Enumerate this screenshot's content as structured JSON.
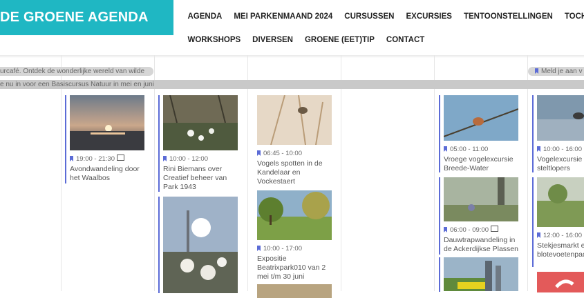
{
  "header": {
    "logo": "DE GROENE AGENDA"
  },
  "nav": {
    "row1": [
      "AGENDA",
      "MEI PARKENMAAND 2024",
      "CURSUSSEN",
      "EXCURSIES",
      "TENTOONSTELLINGEN",
      "TOCHTEN"
    ],
    "row2": [
      "WORKSHOPS",
      "DIVERSEN",
      "GROENE (EET)TIP",
      "CONTACT"
    ]
  },
  "banners": {
    "b1": "urcafé. Ontdek de wonderlijke wereld van wilde",
    "b2": "e nu in voor een Basiscursus Natuur in mei en juni",
    "b3": "Meld je aan v"
  },
  "events": [
    {
      "time": "19:00 - 21:30",
      "title": "Avondwandeling door het Waalbos",
      "recurring": true
    },
    {
      "time": "10:00 - 12:00",
      "title": "Rini Biemans over Creatief beheer van Park 1943",
      "recurring": false
    },
    {
      "time": "06:45 - 10:00",
      "title": "Vogels spotten in de Kandelaar en Vockestaert",
      "recurring": false
    },
    {
      "time": "10:00 - 17:00",
      "title": "Expositie Beatrixpark010 van 2 mei t/m 30 juni",
      "recurring": false
    },
    {
      "time": "05:00 - 11:00",
      "title": "Vroege vogelexcursie Breede-Water",
      "recurring": false
    },
    {
      "time": "06:00 - 09:00",
      "title": "Dauwtrapwandeling in de Ackerdijkse Plassen",
      "recurring": true
    },
    {
      "time": "10:00 - 16:00",
      "title": "Vogelexcursie steltlopers",
      "recurring": false
    },
    {
      "time": "12:00 - 16:00",
      "title": "Stekjesmarkt en blotevoetenpad Erik",
      "recurring": false
    }
  ],
  "colors": {
    "brand": "#1fb7c3",
    "event_accent": "#5b6bd6"
  }
}
